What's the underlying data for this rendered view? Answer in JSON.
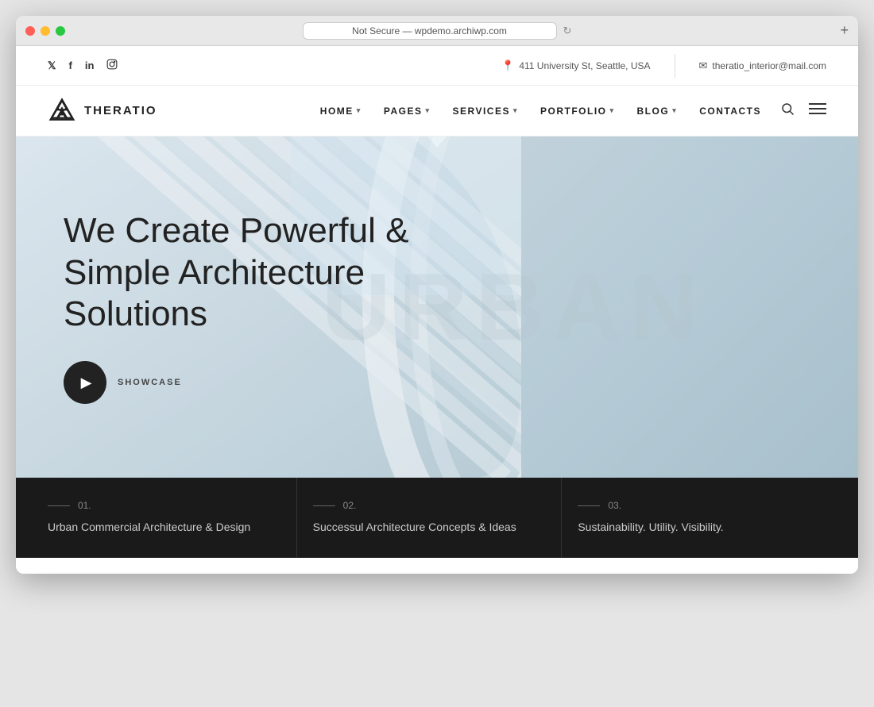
{
  "browser": {
    "url": "Not Secure — wpdemo.archiwp.com",
    "new_tab_label": "+"
  },
  "topbar": {
    "social": {
      "twitter": "t",
      "facebook": "f",
      "linkedin": "in",
      "instagram": "⬡"
    },
    "address_icon": "📍",
    "address": "411 University St, Seattle, USA",
    "email_icon": "✉",
    "email": "theratio_interior@mail.com"
  },
  "navbar": {
    "logo_text": "THERATIO",
    "nav_items": [
      {
        "label": "HOME",
        "has_dropdown": true
      },
      {
        "label": "PAGES",
        "has_dropdown": true
      },
      {
        "label": "SERVICES",
        "has_dropdown": true
      },
      {
        "label": "PORTFOLIO",
        "has_dropdown": true
      },
      {
        "label": "BLOG",
        "has_dropdown": true
      },
      {
        "label": "CONTACTS",
        "has_dropdown": false
      }
    ]
  },
  "hero": {
    "watermark": "URBAN",
    "title": "We Create Powerful & Simple Architecture Solutions",
    "showcase_label": "SHOWCASE",
    "play_button_label": "▶"
  },
  "features": [
    {
      "number": "01.",
      "title": "Urban Commercial Architecture & Design"
    },
    {
      "number": "02.",
      "title": "Successul Architecture Concepts & Ideas"
    },
    {
      "number": "03.",
      "title": "Sustainability. Utility. Visibility."
    }
  ]
}
